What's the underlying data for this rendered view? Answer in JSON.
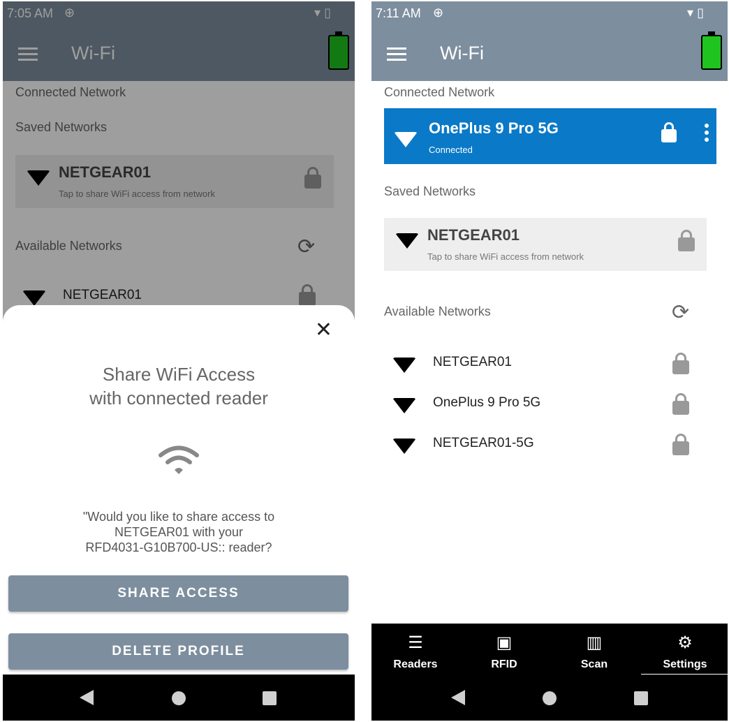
{
  "left": {
    "status_time": "7:05 AM",
    "app_title": "Wi-Fi",
    "connected_network_heading": "Connected Network",
    "saved_networks_heading": "Saved Networks",
    "saved_network": {
      "name": "NETGEAR01",
      "subtitle": "Tap to share WiFi access from network"
    },
    "available_networks_heading": "Available Networks",
    "available_networks": [
      "NETGEAR01"
    ],
    "sheet": {
      "title_line1": "Share WiFi Access",
      "title_line2": "with connected reader",
      "message_line1": "\"Would you like to share access to",
      "message_line2": "NETGEAR01 with your",
      "message_line3": "RFD4031-G10B700-US:: reader?",
      "share_button": "SHARE ACCESS",
      "delete_button": "DELETE PROFILE",
      "close": "✕"
    }
  },
  "right": {
    "status_time": "7:11 AM",
    "app_title": "Wi-Fi",
    "connected_network_heading": "Connected Network",
    "connected_network": {
      "name": "OnePlus 9 Pro 5G",
      "status": "Connected"
    },
    "saved_networks_heading": "Saved Networks",
    "saved_network": {
      "name": "NETGEAR01",
      "subtitle": "Tap to share WiFi access from network"
    },
    "available_networks_heading": "Available Networks",
    "available_networks": [
      "NETGEAR01",
      "OnePlus 9 Pro 5G",
      "NETGEAR01-5G"
    ],
    "tabs": [
      {
        "label": "Readers",
        "icon": "list-icon"
      },
      {
        "label": "RFID",
        "icon": "rfid-icon"
      },
      {
        "label": "Scan",
        "icon": "barcode-icon"
      },
      {
        "label": "Settings",
        "icon": "gear-icon"
      }
    ],
    "selected_tab": "Settings"
  },
  "colors": {
    "app_bar": "#7d8e9e",
    "connected_card": "#0a79c8",
    "battery": "#1fc41f",
    "button": "#7d8e9e"
  }
}
